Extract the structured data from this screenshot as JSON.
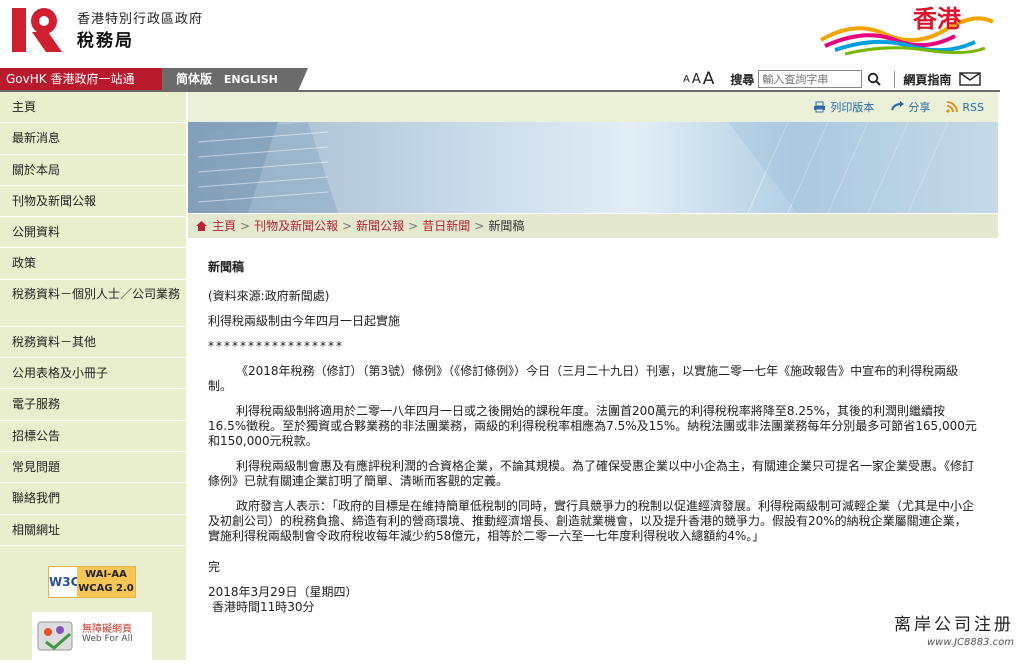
{
  "header": {
    "org_name": "香港特別行政區政府",
    "dept_name": "稅務局",
    "brand_word": "香港"
  },
  "nav": {
    "govhk_label": "GovHK 香港政府一站通",
    "simplified_label": "简体版",
    "english_label": "ENGLISH",
    "font_small": "A",
    "font_medium": "A",
    "font_large": "A",
    "search_label": "搜尋",
    "search_placeholder": "輸入查詢字串",
    "sitemap_label": "網頁指南"
  },
  "sidebar": {
    "items": [
      {
        "label": "主頁"
      },
      {
        "label": "最新消息"
      },
      {
        "label": "關於本局"
      },
      {
        "label": "刊物及新聞公報"
      },
      {
        "label": "公開資料"
      },
      {
        "label": "政策"
      },
      {
        "label": "稅務資料－個別人士／公司業務"
      },
      {
        "label": "稅務資料－其他"
      },
      {
        "label": "公用表格及小冊子"
      },
      {
        "label": "電子服務"
      },
      {
        "label": "招標公告"
      },
      {
        "label": "常見問題"
      },
      {
        "label": "聯絡我們"
      },
      {
        "label": "相關網址"
      }
    ],
    "w3c_logo": "W3C",
    "wcag_line1": "WAI-AA",
    "wcag_line2": "WCAG 2.0",
    "webforall_line1": "無障礙網頁",
    "webforall_line2": "Web For All"
  },
  "utility": {
    "print_label": "列印版本",
    "share_label": "分享",
    "rss_label": "RSS"
  },
  "breadcrumb": {
    "items": [
      "主頁",
      "刊物及新聞公報",
      "新聞公報",
      "昔日新聞"
    ],
    "current": "新聞稿"
  },
  "article": {
    "title": "新聞稿",
    "source": "(資料來源:政府新聞處)",
    "headline": "利得稅兩級制由今年四月一日起實施",
    "stars": "*****************",
    "p1": "《2018年稅務（修訂）（第3號）條例》（《修訂條例》）今日（三月二十九日）刊憲，以實施二零一七年《施政報告》中宣布的利得稅兩級制。",
    "p2": "利得稅兩級制將適用於二零一八年四月一日或之後開始的課稅年度。法團首200萬元的利得稅稅率將降至8.25%，其後的利潤則繼續按16.5%徵稅。至於獨資或合夥業務的非法團業務，兩級的利得稅稅率相應為7.5%及15%。納稅法團或非法團業務每年分別最多可節省165,000元和150,000元稅款。",
    "p3": "利得稅兩級制會惠及有應評稅利潤的合資格企業，不論其規模。為了確保受惠企業以中小企為主，有關連企業只可提名一家企業受惠。《修訂條例》已就有關連企業訂明了簡單、清晰而客觀的定義。",
    "p4": "政府發言人表示：「政府的目標是在維持簡單低稅制的同時，實行具競爭力的稅制以促進經濟發展。利得稅兩級制可減輕企業（尤其是中小企及初創公司）的稅務負擔、締造有利的營商環境、推動經濟增長、創造就業機會，以及提升香港的競爭力。假設有20%的納稅企業屬關連企業，實施利得稅兩級制會令政府稅收每年減少約58億元，相等於二零一六至一七年度利得稅收入總額約4%。」",
    "end": "完",
    "date": "2018年3月29日（星期四）",
    "time": "香港時間11時30分"
  },
  "watermark": {
    "line1": "离岸公司注册",
    "line2": "www.JC8883.com"
  },
  "colors": {
    "brand_red": "#b8192c",
    "sidebar_bg": "#e9efcd",
    "link_red": "#b52633"
  }
}
